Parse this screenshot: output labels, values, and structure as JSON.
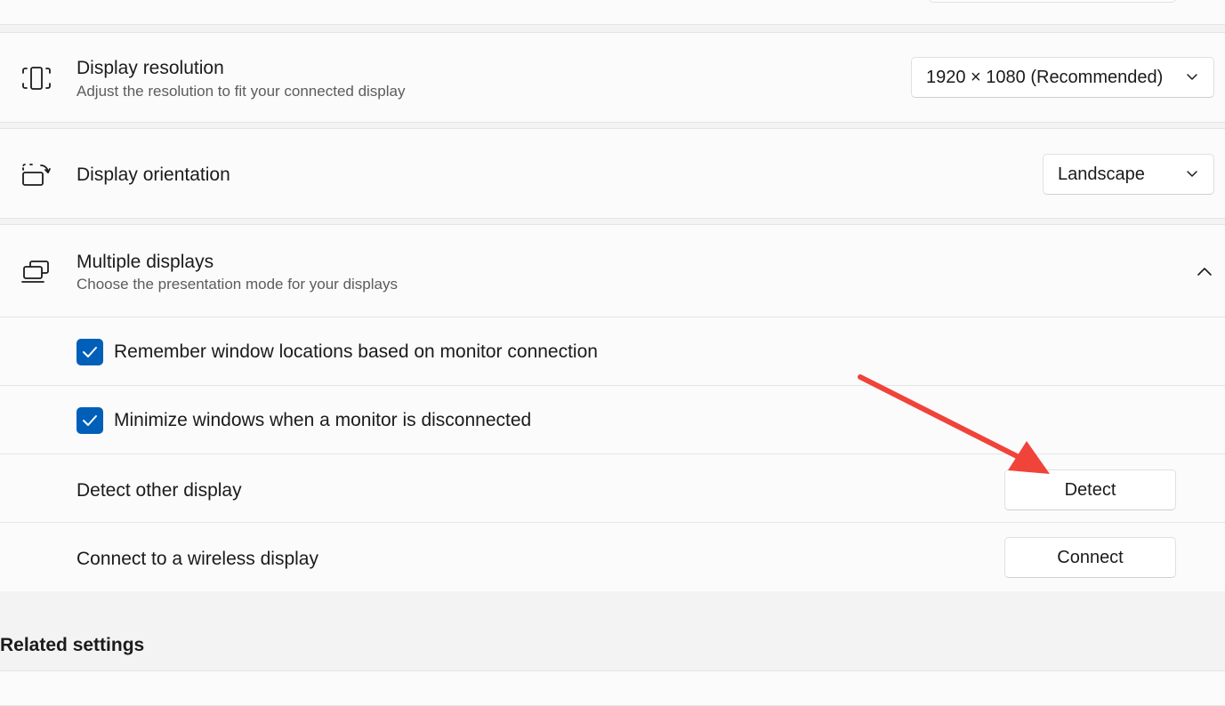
{
  "display_resolution": {
    "title": "Display resolution",
    "subtitle": "Adjust the resolution to fit your connected display",
    "value": "1920 × 1080 (Recommended)",
    "icon": "resolution-icon"
  },
  "display_orientation": {
    "title": "Display orientation",
    "value": "Landscape",
    "icon": "orientation-icon"
  },
  "multiple_displays": {
    "title": "Multiple displays",
    "subtitle": "Choose the presentation mode for your displays",
    "icon": "multiple-displays-icon",
    "expanded": true,
    "remember_label": "Remember window locations based on monitor connection",
    "remember_checked": true,
    "minimize_label": "Minimize windows when a monitor is disconnected",
    "minimize_checked": true,
    "detect_label": "Detect other display",
    "detect_button": "Detect",
    "connect_label": "Connect to a wireless display",
    "connect_button": "Connect"
  },
  "related": {
    "heading": "Related settings"
  },
  "colors": {
    "accent": "#005fb8",
    "annotation_arrow": "#f0433a"
  }
}
